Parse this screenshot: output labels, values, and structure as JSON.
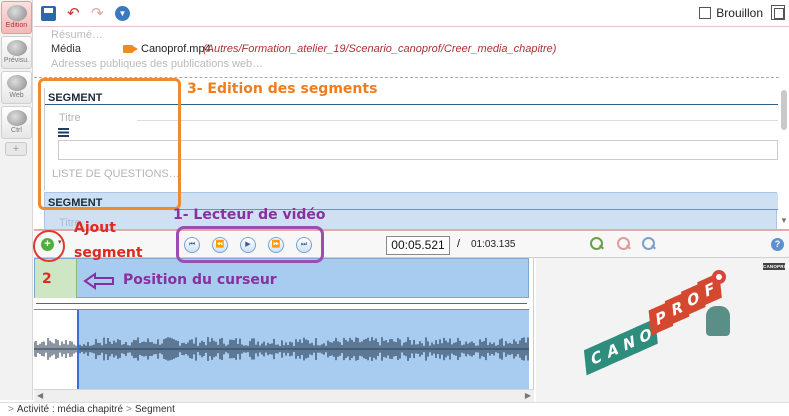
{
  "side_tabs": [
    {
      "label": "Edition"
    },
    {
      "label": "Prévisu."
    },
    {
      "label": "Web"
    },
    {
      "label": "Ctrl"
    }
  ],
  "side_add": "+",
  "toolbar": {
    "draft_label": "Brouillon"
  },
  "meta": {
    "resume": "Résumé…",
    "media_label": "Média",
    "media_file": "Canoprof.mp4",
    "media_path": "(Autres/Formation_atelier_19/Scenario_canoprof/Creer_media_chapitre)",
    "adresses": "Adresses publiques des publications web…"
  },
  "segments": [
    {
      "title": "SEGMENT",
      "titre_label": "Titre",
      "liste_label": "LISTE DE QUESTIONS…"
    },
    {
      "title": "SEGMENT",
      "titre_label": "Titre"
    }
  ],
  "player": {
    "current_time": "00:05.521",
    "separator": "/",
    "total_time": "01:03.135",
    "add_symbol": "+",
    "caret": "▾",
    "info_symbol": "?"
  },
  "video": {
    "watermark": "CANOPROF",
    "board_letters": [
      "C",
      "A",
      "N",
      "O",
      "P",
      "R",
      "O",
      "F"
    ],
    "letter_colors": [
      "#2e8d7d",
      "#2e8d7d",
      "#2e8d7d",
      "#2e8d7d",
      "#d4482f",
      "#d4482f",
      "#d4482f",
      "#d4482f"
    ]
  },
  "status": {
    "sep": ">",
    "crumbs": [
      "Activité : média chapitré",
      "Segment"
    ]
  },
  "annotations": {
    "edition": "3- Edition des segments",
    "lecteur": "1- Lecteur de vidéo",
    "ajout1": "Ajout",
    "ajout2": "segment",
    "num2": "2",
    "position": "Position du curseur"
  },
  "colors": {
    "accent_blue": "#2f67a8",
    "segment_blue": "#a8cbf0",
    "segment_green": "#cfe6c4",
    "annotation_orange": "#f07d1d",
    "annotation_purple": "#8a2f9f",
    "annotation_red": "#e0281e"
  }
}
